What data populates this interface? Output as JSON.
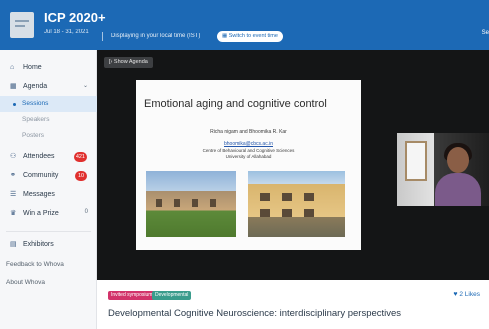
{
  "header": {
    "title": "ICP 2020+",
    "dates": "Jul 18 - 31, 2021",
    "timezone_note": "Displaying in your local time (IST)",
    "switch_button": "Switch to event time",
    "right_text": "Se"
  },
  "sidebar": {
    "home": "Home",
    "agenda": "Agenda",
    "sessions": "Sessions",
    "speakers": "Speakers",
    "posters": "Posters",
    "attendees": "Attendees",
    "attendees_count": "421",
    "community": "Community",
    "community_count": "10",
    "messages": "Messages",
    "win_prize": "Win a Prize",
    "win_prize_count": "0",
    "exhibitors": "Exhibitors",
    "feedback": "Feedback to Whova",
    "about": "About Whova"
  },
  "stage": {
    "show_agenda": "Show Agenda",
    "slide": {
      "title": "Emotional aging and cognitive control",
      "authors": "Richa nigam and Bhoomika R. Kar",
      "email": "bhoomika@cbcs.ac.in",
      "affiliation1": "Centre of Behavioural and Cognitive Sciences",
      "affiliation2": "University of Allahabad"
    }
  },
  "session": {
    "tag1": "Invited symposium",
    "tag2": "Developmental",
    "likes": "2 Likes",
    "title": "Developmental Cognitive Neuroscience: interdisciplinary perspectives"
  },
  "colors": {
    "header_blue": "#1c69b5",
    "badge_red": "#e0302e",
    "tag_pink": "#d2336a",
    "tag_teal": "#3a9c8c"
  }
}
